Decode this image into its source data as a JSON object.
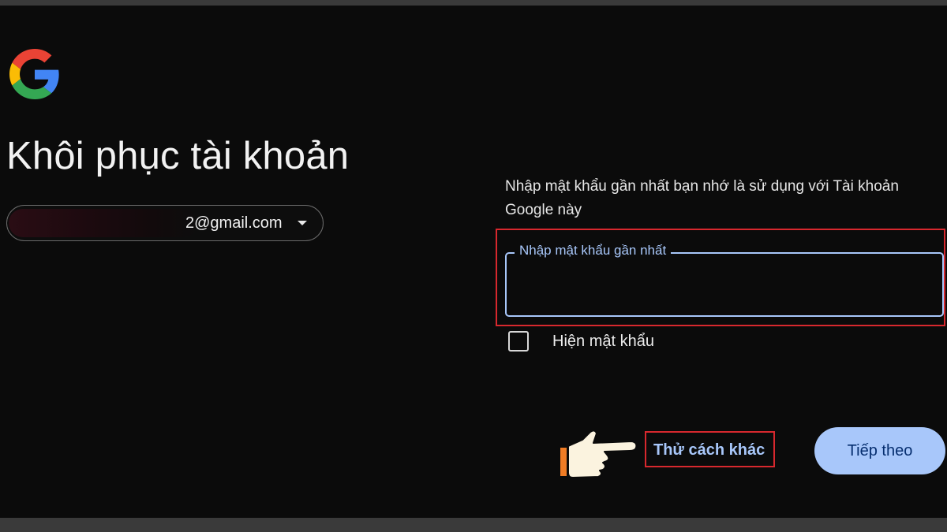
{
  "page": {
    "title": "Khôi phục tài khoản"
  },
  "account": {
    "email_visible": "2@gmail.com"
  },
  "form": {
    "instruction": "Nhập mật khẩu gần nhất bạn nhớ là sử dụng với Tài khoản Google này",
    "password_label": "Nhập mật khẩu gần nhất",
    "password_value": "",
    "show_password_label": "Hiện mật khẩu",
    "show_password_checked": false
  },
  "actions": {
    "try_another_label": "Thử cách khác",
    "next_label": "Tiếp theo"
  },
  "colors": {
    "accent": "#a8c7fa",
    "highlight": "#d8282e",
    "background": "#0b0b0b"
  },
  "icons": {
    "logo": "google-g-logo-icon",
    "dropdown": "caret-down-icon",
    "pointer": "pointing-hand-icon"
  }
}
